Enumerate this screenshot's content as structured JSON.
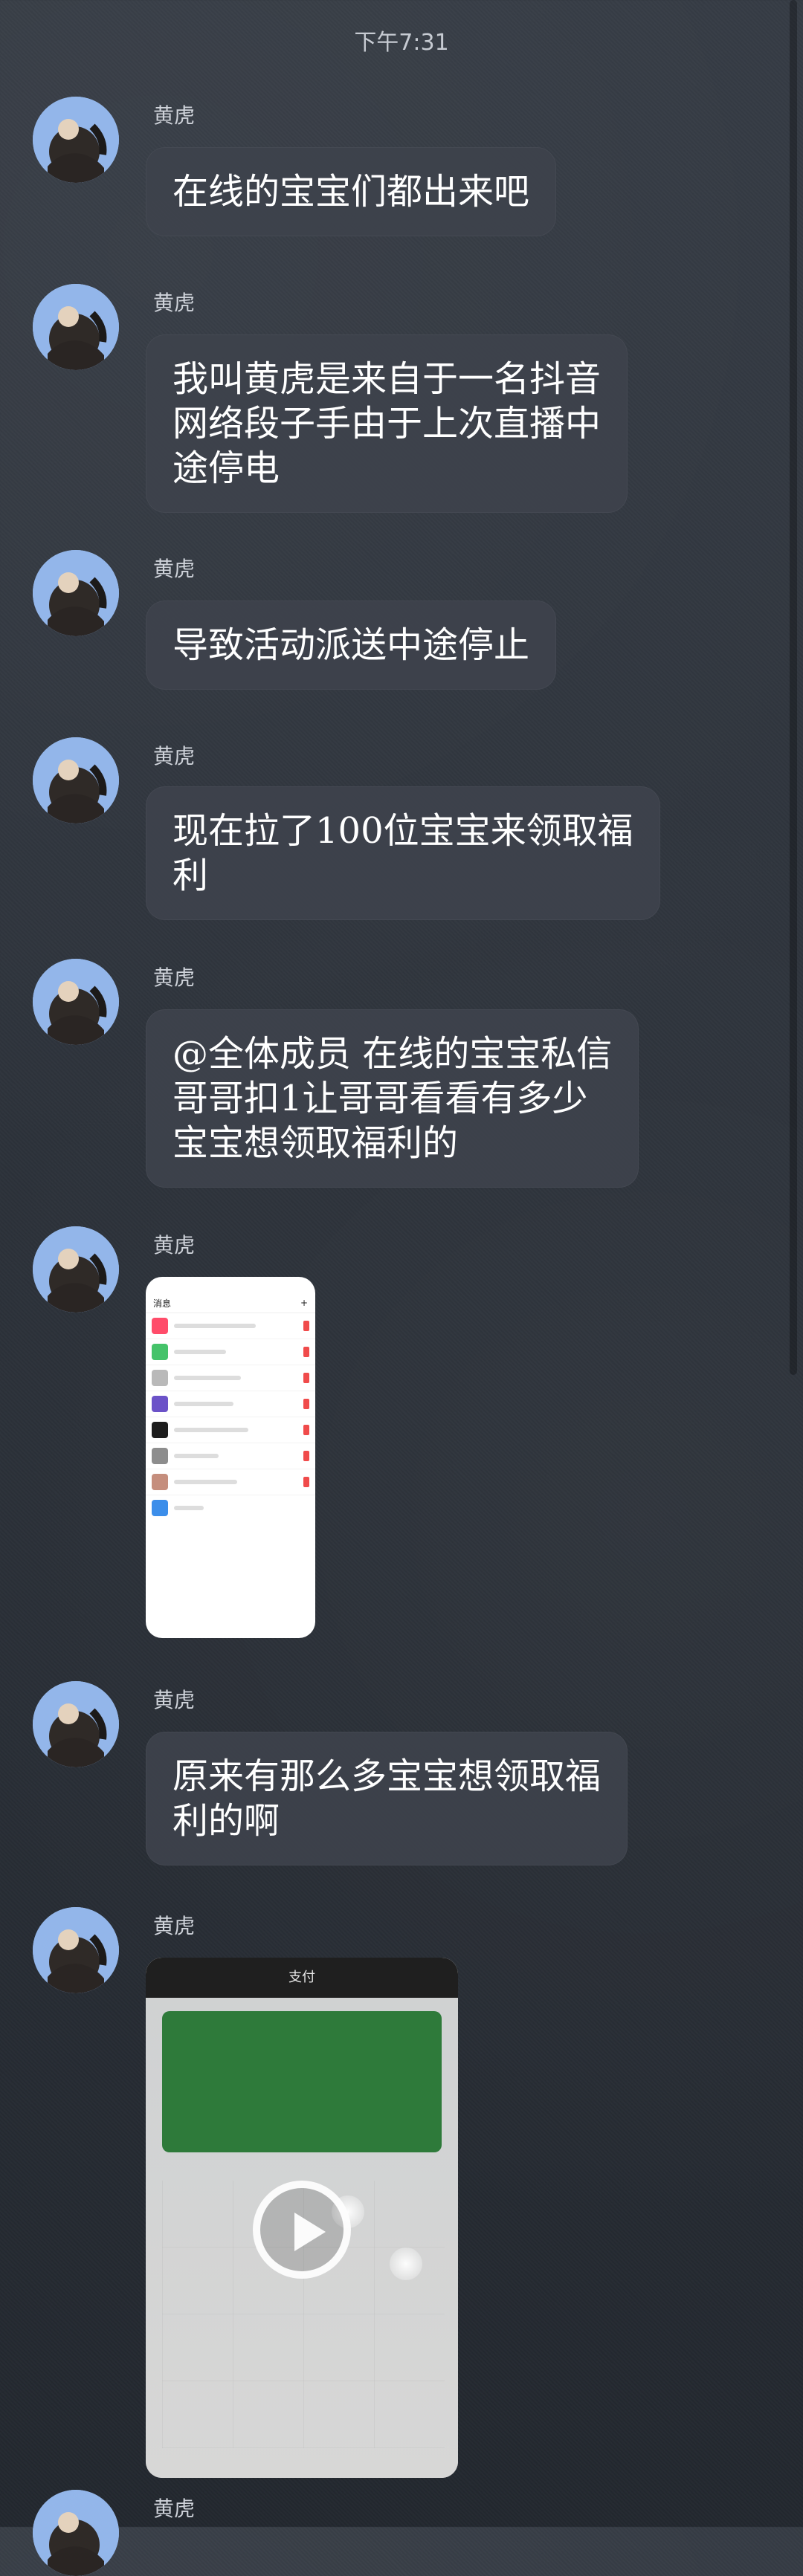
{
  "status_bar": {
    "time": "下午7:31"
  },
  "messages": [
    {
      "sender": "黄虎",
      "type": "text",
      "text": "在线的宝宝们都出来吧"
    },
    {
      "sender": "黄虎",
      "type": "text",
      "text": "我叫黄虎是来自于一名抖音\n网络段子手由于上次直播中\n途停电"
    },
    {
      "sender": "黄虎",
      "type": "text",
      "text": "导致活动派送中途停止"
    },
    {
      "sender": "黄虎",
      "type": "text",
      "text": "现在拉了100位宝宝来领取福\n利"
    },
    {
      "sender": "黄虎",
      "type": "text",
      "text": "@全体成员 在线的宝宝私信\n哥哥扣1让哥哥看看有多少\n宝宝想领取福利的"
    },
    {
      "sender": "黄虎",
      "type": "image"
    },
    {
      "sender": "黄虎",
      "type": "text",
      "text": "原来有那么多宝宝想领取福\n利的啊"
    },
    {
      "sender": "黄虎",
      "type": "video"
    }
  ],
  "media": {
    "phone_screenshot": {
      "title": "消息"
    },
    "video_thumbnail": {
      "title": "支付"
    }
  },
  "icons": {
    "play": "play-icon",
    "scroll": "scroll-indicator"
  }
}
